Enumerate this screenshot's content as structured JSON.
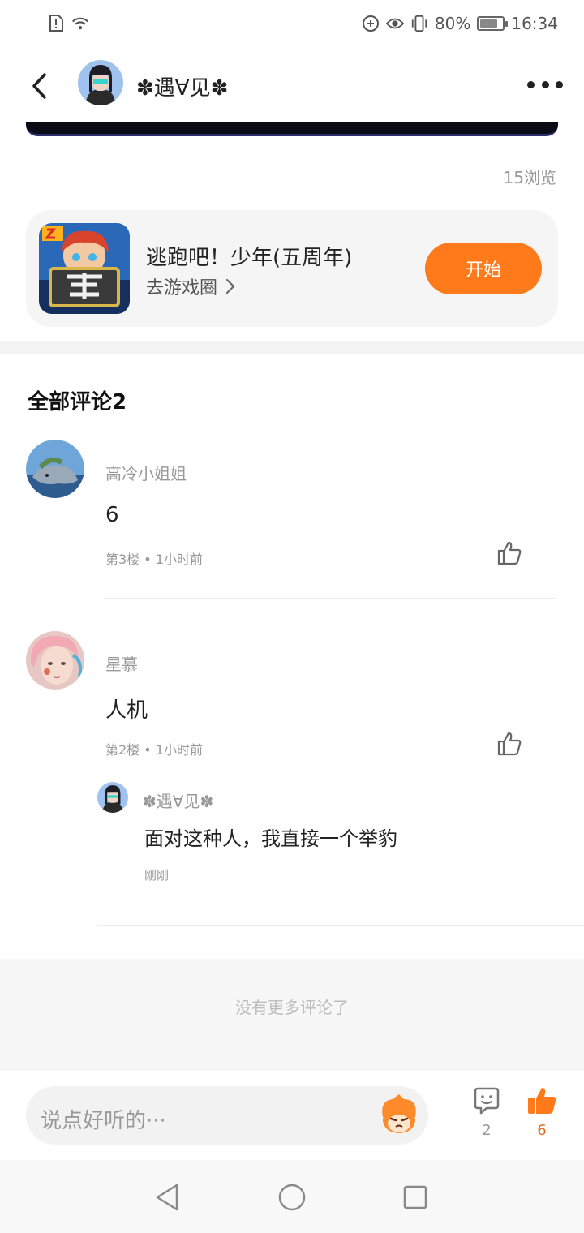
{
  "status_bar": {
    "battery": "80%",
    "time": "16:34",
    "battery_level": 0.8
  },
  "header": {
    "username": "✽遇∀见✽"
  },
  "post": {
    "views": "15浏览"
  },
  "game_card": {
    "title": "逃跑吧！少年(五周年)",
    "link_label": "去游戏圈",
    "button_label": "开始"
  },
  "comments": {
    "title": "全部评论2",
    "items": [
      {
        "name": "高冷小姐姐",
        "text": "6",
        "meta": "第3楼 • 1小时前"
      },
      {
        "name": "星慕",
        "text": "人机",
        "meta": "第2楼 • 1小时前",
        "reply": {
          "name": "✽遇∀见✽",
          "text": "面对这种人，我直接一个举豹",
          "time": "刚刚"
        }
      }
    ],
    "no_more": "没有更多评论了"
  },
  "bottom_bar": {
    "input_placeholder": "说点好听的···",
    "comment_count": "2",
    "like_count": "6"
  },
  "colors": {
    "accent": "#ff7a1a",
    "muted_text": "#999999"
  }
}
